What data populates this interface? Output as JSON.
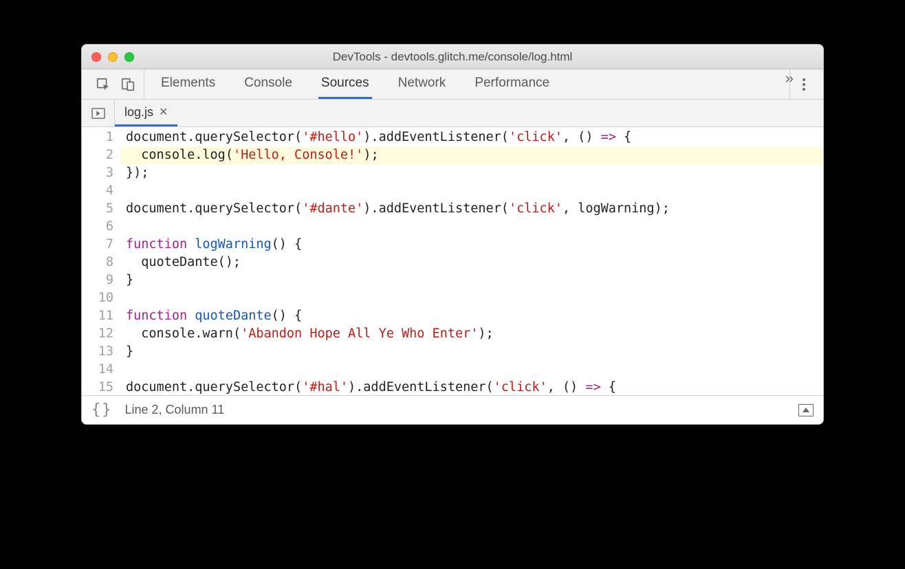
{
  "window": {
    "title": "DevTools - devtools.glitch.me/console/log.html"
  },
  "toolbar": {
    "tabs": [
      "Elements",
      "Console",
      "Sources",
      "Network",
      "Performance"
    ],
    "active_tab_index": 2
  },
  "open_file": {
    "name": "log.js"
  },
  "status": {
    "cursor": "Line 2, Column 11"
  },
  "code": {
    "highlighted_line": 2,
    "lines": [
      [
        {
          "t": "document",
          "c": ""
        },
        {
          "t": ".",
          "c": "tok-punc"
        },
        {
          "t": "querySelector",
          "c": ""
        },
        {
          "t": "(",
          "c": "tok-punc"
        },
        {
          "t": "'#hello'",
          "c": "tok-str"
        },
        {
          "t": ").",
          "c": "tok-punc"
        },
        {
          "t": "addEventListener",
          "c": ""
        },
        {
          "t": "(",
          "c": "tok-punc"
        },
        {
          "t": "'click'",
          "c": "tok-str"
        },
        {
          "t": ", () ",
          "c": ""
        },
        {
          "t": "=>",
          "c": "tok-kw"
        },
        {
          "t": " {",
          "c": "tok-punc"
        }
      ],
      [
        {
          "t": "  console",
          "c": ""
        },
        {
          "t": ".",
          "c": "tok-punc"
        },
        {
          "t": "log",
          "c": ""
        },
        {
          "t": "(",
          "c": "tok-punc"
        },
        {
          "t": "'Hello, Console!'",
          "c": "tok-str"
        },
        {
          "t": ");",
          "c": "tok-punc"
        }
      ],
      [
        {
          "t": "});",
          "c": "tok-punc"
        }
      ],
      [],
      [
        {
          "t": "document",
          "c": ""
        },
        {
          "t": ".",
          "c": "tok-punc"
        },
        {
          "t": "querySelector",
          "c": ""
        },
        {
          "t": "(",
          "c": "tok-punc"
        },
        {
          "t": "'#dante'",
          "c": "tok-str"
        },
        {
          "t": ").",
          "c": "tok-punc"
        },
        {
          "t": "addEventListener",
          "c": ""
        },
        {
          "t": "(",
          "c": "tok-punc"
        },
        {
          "t": "'click'",
          "c": "tok-str"
        },
        {
          "t": ", logWarning);",
          "c": ""
        }
      ],
      [],
      [
        {
          "t": "function",
          "c": "tok-kw"
        },
        {
          "t": " ",
          "c": ""
        },
        {
          "t": "logWarning",
          "c": "tok-fn"
        },
        {
          "t": "() {",
          "c": "tok-punc"
        }
      ],
      [
        {
          "t": "  quoteDante",
          "c": ""
        },
        {
          "t": "();",
          "c": "tok-punc"
        }
      ],
      [
        {
          "t": "}",
          "c": "tok-punc"
        }
      ],
      [],
      [
        {
          "t": "function",
          "c": "tok-kw"
        },
        {
          "t": " ",
          "c": ""
        },
        {
          "t": "quoteDante",
          "c": "tok-fn"
        },
        {
          "t": "() {",
          "c": "tok-punc"
        }
      ],
      [
        {
          "t": "  console",
          "c": ""
        },
        {
          "t": ".",
          "c": "tok-punc"
        },
        {
          "t": "warn",
          "c": ""
        },
        {
          "t": "(",
          "c": "tok-punc"
        },
        {
          "t": "'Abandon Hope All Ye Who Enter'",
          "c": "tok-str"
        },
        {
          "t": ");",
          "c": "tok-punc"
        }
      ],
      [
        {
          "t": "}",
          "c": "tok-punc"
        }
      ],
      [],
      [
        {
          "t": "document",
          "c": ""
        },
        {
          "t": ".",
          "c": "tok-punc"
        },
        {
          "t": "querySelector",
          "c": ""
        },
        {
          "t": "(",
          "c": "tok-punc"
        },
        {
          "t": "'#hal'",
          "c": "tok-str"
        },
        {
          "t": ").",
          "c": "tok-punc"
        },
        {
          "t": "addEventListener",
          "c": ""
        },
        {
          "t": "(",
          "c": "tok-punc"
        },
        {
          "t": "'click'",
          "c": "tok-str"
        },
        {
          "t": ", () ",
          "c": ""
        },
        {
          "t": "=>",
          "c": "tok-kw"
        },
        {
          "t": " {",
          "c": "tok-punc"
        }
      ]
    ]
  }
}
